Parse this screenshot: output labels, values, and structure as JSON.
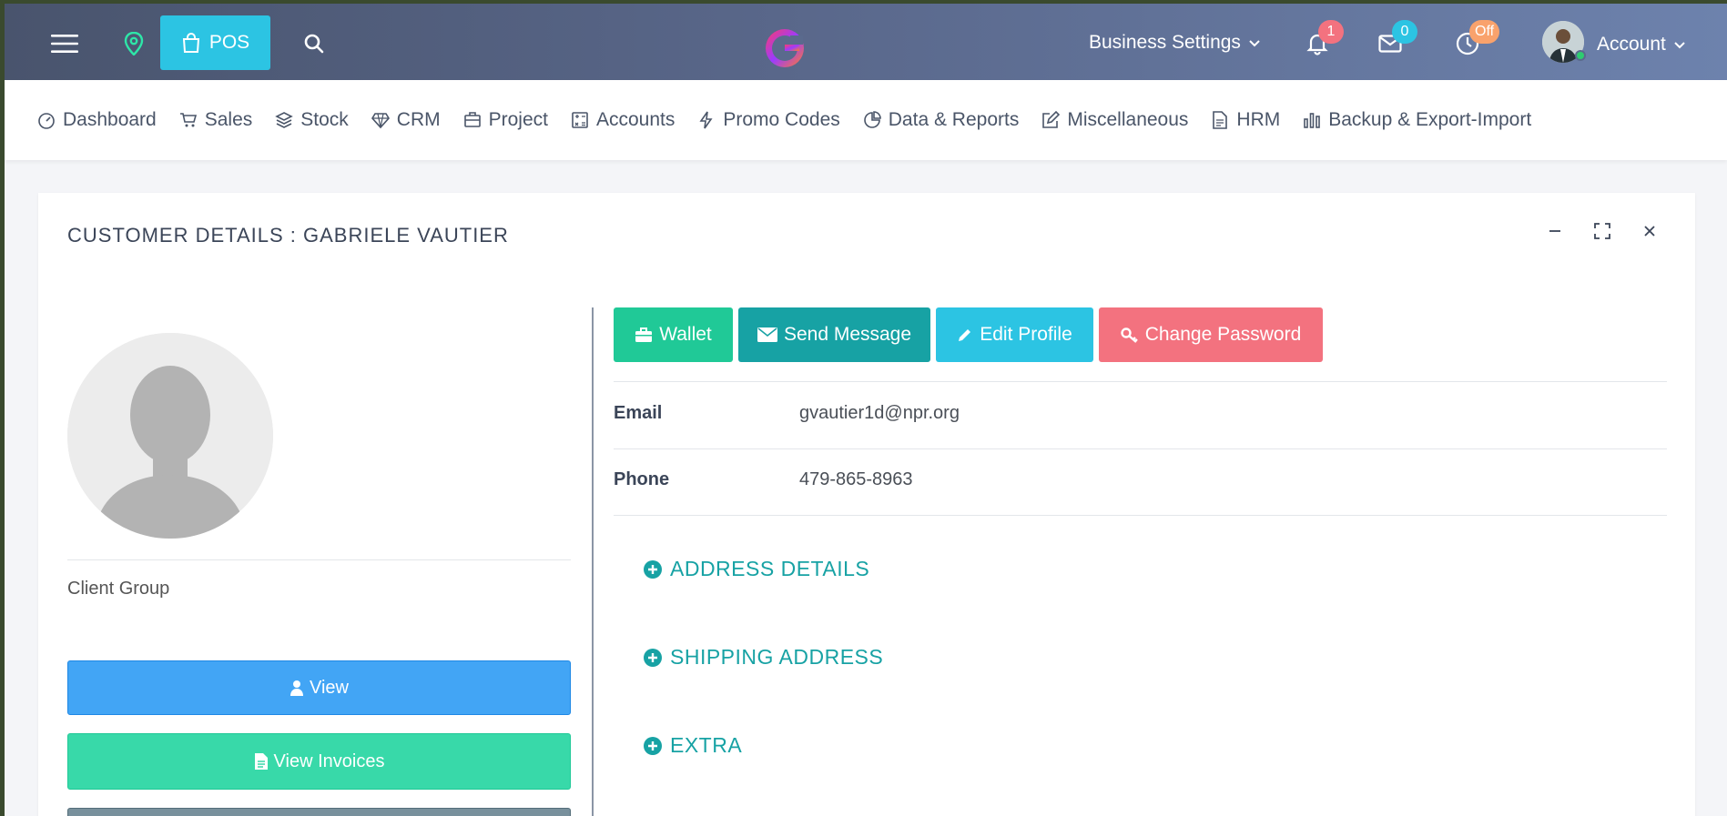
{
  "topbar": {
    "pos_label": "POS",
    "business_settings": "Business Settings",
    "notifications_count": "1",
    "messages_count": "0",
    "clock_status": "Off",
    "account_label": "Account",
    "colors": {
      "pos": "#2cc4e3",
      "notif_badge": "#f3727f",
      "msg_badge": "#2cc4e3",
      "clock_badge": "#f9a26c"
    }
  },
  "nav": {
    "items": [
      {
        "label": "Dashboard",
        "icon": "gauge-icon"
      },
      {
        "label": "Sales",
        "icon": "cart-icon"
      },
      {
        "label": "Stock",
        "icon": "layers-icon"
      },
      {
        "label": "CRM",
        "icon": "diamond-icon"
      },
      {
        "label": "Project",
        "icon": "briefcase-icon"
      },
      {
        "label": "Accounts",
        "icon": "calculator-icon"
      },
      {
        "label": "Promo Codes",
        "icon": "bolt-icon"
      },
      {
        "label": "Data & Reports",
        "icon": "pie-icon"
      },
      {
        "label": "Miscellaneous",
        "icon": "edit-icon"
      },
      {
        "label": "HRM",
        "icon": "document-icon"
      },
      {
        "label": "Backup & Export-Import",
        "icon": "bar-chart-icon"
      }
    ]
  },
  "card": {
    "title": "CUSTOMER DETAILS : GABRIELE VAUTIER",
    "client_group_label": "Client Group",
    "view_label": "View",
    "view_invoices_label": "View Invoices",
    "actions": {
      "wallet": "Wallet",
      "send_message": "Send Message",
      "edit_profile": "Edit Profile",
      "change_password": "Change Password"
    },
    "email_label": "Email",
    "email_value": "gvautier1d@npr.org",
    "phone_label": "Phone",
    "phone_value": "479-865-8963",
    "sections": [
      "ADDRESS DETAILS",
      "SHIPPING ADDRESS",
      "EXTRA"
    ]
  }
}
